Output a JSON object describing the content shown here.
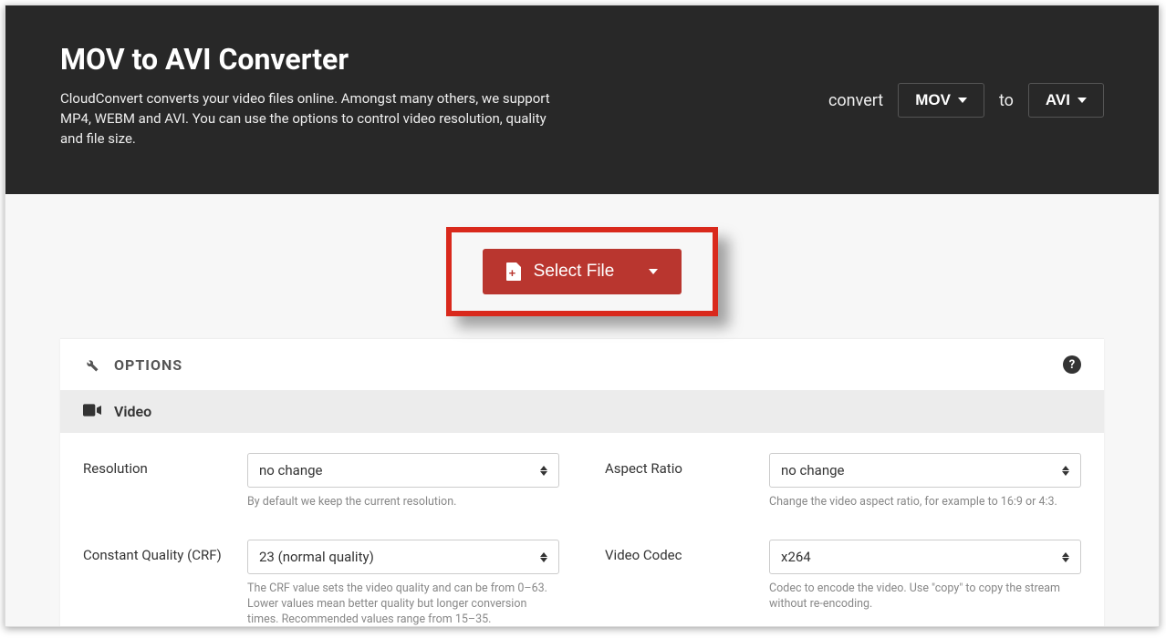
{
  "hero": {
    "title": "MOV to AVI Converter",
    "description": "CloudConvert converts your video files online. Amongst many others, we support MP4, WEBM and AVI. You can use the options to control video resolution, quality and file size.",
    "convert_label": "convert",
    "from_format": "MOV",
    "to_label": "to",
    "to_format": "AVI"
  },
  "select_file": {
    "label": "Select File"
  },
  "options": {
    "header": "OPTIONS",
    "help_symbol": "?",
    "section_video": "Video",
    "fields": {
      "resolution": {
        "label": "Resolution",
        "value": "no change",
        "hint": "By default we keep the current resolution."
      },
      "aspect_ratio": {
        "label": "Aspect Ratio",
        "value": "no change",
        "hint": "Change the video aspect ratio, for example to 16:9 or 4:3."
      },
      "crf": {
        "label": "Constant Quality (CRF)",
        "value": "23 (normal quality)",
        "hint": "The CRF value sets the video quality and can be from 0–63. Lower values mean better quality but longer conversion times. Recommended values range from 15–35."
      },
      "codec": {
        "label": "Video Codec",
        "value": "x264",
        "hint": "Codec to encode the video. Use \"copy\" to copy the stream without re-encoding."
      }
    }
  }
}
